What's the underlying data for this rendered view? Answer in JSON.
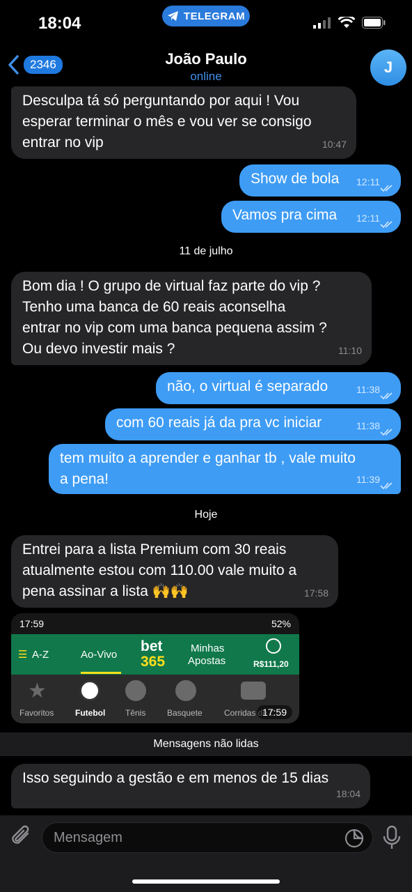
{
  "status_bar": {
    "time": "18:04",
    "app_pill": "TELEGRAM"
  },
  "header": {
    "back_count": "2346",
    "name": "João Paulo",
    "status": "online",
    "avatar_letter": "J"
  },
  "messages": [
    {
      "dir": "in",
      "lines": [
        "Desculpa tá só perguntando por aqui ! Vou",
        "esperar terminar o mês e vou ver se consigo",
        "entrar no vip"
      ],
      "time": "10:47"
    },
    {
      "dir": "out",
      "text": "Show de bola",
      "time": "12:11"
    },
    {
      "dir": "out",
      "text": "Vamos pra cima",
      "time": "12:11"
    },
    {
      "dir": "in",
      "lines": [
        "Bom dia ! O grupo de virtual faz parte do vip ?",
        "Tenho uma banca de 60 reais aconselha",
        "entrar no vip com uma banca pequena assim ?",
        "Ou devo investir mais ?"
      ],
      "time": "11:10"
    },
    {
      "dir": "out",
      "text": "não, o virtual é separado",
      "time": "11:38"
    },
    {
      "dir": "out",
      "text": "com 60 reais já da pra vc iniciar",
      "time": "11:38"
    },
    {
      "dir": "out",
      "lines": [
        "tem muito a aprender e ganhar tb , vale muito",
        "a pena!"
      ],
      "time": "11:39"
    },
    {
      "dir": "in",
      "lines": [
        "Entrei para a lista Premium com 30 reais",
        "atualmente estou com 110.00 vale muito a",
        "pena assinar a lista 🙌🙌"
      ],
      "time": "17:58"
    },
    {
      "dir": "in",
      "text": "Isso seguindo a gestão e em menos de 15 dias",
      "time": "18:04"
    }
  ],
  "date_separators": [
    "11 de julho",
    "Hoje"
  ],
  "screenshot": {
    "status_time": "17:59",
    "battery": "52%",
    "nav": {
      "az": "A-Z",
      "live": "Ao-Vivo",
      "logo_top": "bet",
      "logo_bottom": "365",
      "my_bets_1": "Minhas",
      "my_bets_2": "Apostas",
      "balance": "R$111,20"
    },
    "tabs": [
      "Favoritos",
      "Futebol",
      "Tênis",
      "Basquete",
      "Corridas de C..."
    ],
    "time": "17:59"
  },
  "unread_label": "Mensagens não lidas",
  "input": {
    "placeholder": "Mensagem"
  },
  "colors": {
    "incoming": "#262628",
    "outgoing": "#3e9cf5",
    "accent": "#2a7bdc",
    "bet365_green": "#10784a",
    "bet365_yellow": "#ffdf1b"
  }
}
